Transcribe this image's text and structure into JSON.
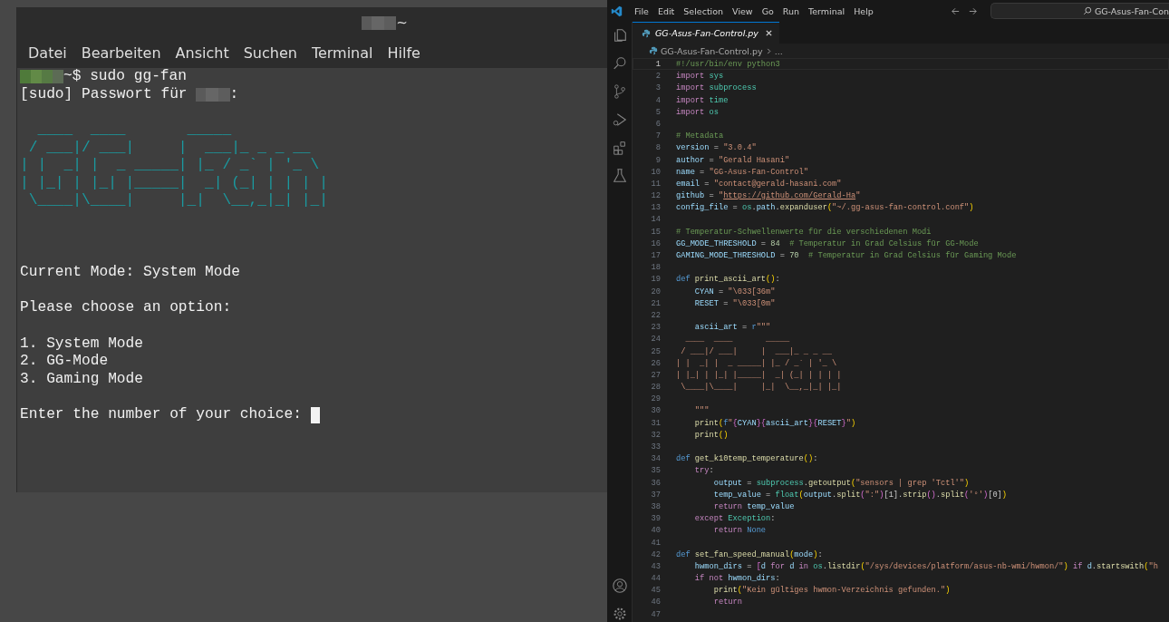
{
  "terminal": {
    "title": "~",
    "menu": [
      "Datei",
      "Bearbeiten",
      "Ansicht",
      "Suchen",
      "Terminal",
      "Hilfe"
    ],
    "lines": [
      {
        "kind": "prompt",
        "text": "~$ sudo gg-fan"
      },
      {
        "kind": "sudo",
        "text": "[sudo] Passwort für",
        "suffix": ":"
      },
      {
        "kind": "blank"
      },
      {
        "kind": "art",
        "text": "  ____  ____       _____"
      },
      {
        "kind": "art",
        "text": " / ___|/ ___|     |  ___|_ _ _ __"
      },
      {
        "kind": "art",
        "text": "| |  _| |  _ _____| |_ / _` | '_ \\"
      },
      {
        "kind": "art",
        "text": "| |_| | |_| |_____|  _| (_| | | | |"
      },
      {
        "kind": "art",
        "text": " \\____|\\____|     |_|  \\__,_|_| |_|"
      },
      {
        "kind": "blank"
      },
      {
        "kind": "blank"
      },
      {
        "kind": "blank"
      },
      {
        "kind": "text",
        "text": "Current Mode: System Mode"
      },
      {
        "kind": "blank"
      },
      {
        "kind": "text",
        "text": "Please choose an option:"
      },
      {
        "kind": "blank"
      },
      {
        "kind": "text",
        "text": "1. System Mode"
      },
      {
        "kind": "text",
        "text": "2. GG-Mode"
      },
      {
        "kind": "text",
        "text": "3. Gaming Mode"
      },
      {
        "kind": "blank"
      },
      {
        "kind": "input",
        "text": "Enter the number of your choice:"
      }
    ]
  },
  "editor": {
    "menu": [
      "File",
      "Edit",
      "Selection",
      "View",
      "Go",
      "Run",
      "Terminal",
      "Help"
    ],
    "search": {
      "value": "GG-Asus-Fan-Con"
    },
    "tabs": [
      {
        "label": "GG-Asus-Fan-Control.py",
        "selected": true
      }
    ],
    "breadcrumb": [
      "GG-Asus-Fan-Control.py",
      "..."
    ],
    "lines": [
      {
        "number": "1",
        "current": true,
        "tokens": [
          {
            "kind": "cm",
            "text": "#!/usr/bin/env python3"
          }
        ]
      },
      {
        "number": "2",
        "current": false,
        "tokens": [
          {
            "kind": "kw",
            "text": "import"
          },
          {
            "kind": "mod",
            "text": " sys"
          }
        ]
      },
      {
        "number": "3",
        "current": false,
        "tokens": [
          {
            "kind": "kw",
            "text": "import"
          },
          {
            "kind": "mod",
            "text": " subprocess"
          }
        ]
      },
      {
        "number": "4",
        "current": false,
        "tokens": [
          {
            "kind": "kw",
            "text": "import"
          },
          {
            "kind": "mod",
            "text": " time"
          }
        ]
      },
      {
        "number": "5",
        "current": false,
        "tokens": [
          {
            "kind": "kw",
            "text": "import"
          },
          {
            "kind": "mod",
            "text": " os"
          }
        ]
      },
      {
        "number": "6",
        "current": false
      },
      {
        "number": "7",
        "current": false,
        "tokens": [
          {
            "kind": "cm",
            "text": "# Metadata"
          }
        ]
      },
      {
        "number": "8",
        "current": false,
        "tokens": [
          {
            "kind": "var",
            "text": "version"
          },
          {
            "kind": "pl",
            "text": " = "
          },
          {
            "kind": "str",
            "text": "\"3.0.4\""
          }
        ]
      },
      {
        "number": "9",
        "current": false,
        "tokens": [
          {
            "kind": "var",
            "text": "author"
          },
          {
            "kind": "pl",
            "text": " = "
          },
          {
            "kind": "str",
            "text": "\"Gerald Hasani\""
          }
        ]
      },
      {
        "number": "10",
        "current": false,
        "tokens": [
          {
            "kind": "var",
            "text": "name"
          },
          {
            "kind": "pl",
            "text": " = "
          },
          {
            "kind": "str",
            "text": "\"GG-Asus-Fan-Control\""
          }
        ]
      },
      {
        "number": "11",
        "current": false,
        "tokens": [
          {
            "kind": "var",
            "text": "email"
          },
          {
            "kind": "pl",
            "text": " = "
          },
          {
            "kind": "str",
            "text": "\"contact@gerald-hasani.com\""
          }
        ]
      },
      {
        "number": "12",
        "current": false,
        "tokens": [
          {
            "kind": "var",
            "text": "github"
          },
          {
            "kind": "pl",
            "text": " = "
          },
          {
            "kind": "str",
            "text": "\""
          },
          {
            "kind": "link",
            "text": "https://github.com/Gerald-Ha"
          },
          {
            "kind": "str",
            "text": "\""
          }
        ]
      },
      {
        "number": "13",
        "current": false,
        "tokens": [
          {
            "kind": "var",
            "text": "config_file"
          },
          {
            "kind": "pl",
            "text": " = "
          },
          {
            "kind": "mod",
            "text": "os"
          },
          {
            "kind": "pl",
            "text": "."
          },
          {
            "kind": "var",
            "text": "path"
          },
          {
            "kind": "pl",
            "text": "."
          },
          {
            "kind": "fn",
            "text": "expanduser"
          },
          {
            "kind": "br",
            "text": "("
          },
          {
            "kind": "str",
            "text": "\"~/.gg-asus-fan-control.conf\""
          },
          {
            "kind": "br",
            "text": ")"
          }
        ]
      },
      {
        "number": "14",
        "current": false
      },
      {
        "number": "15",
        "current": false,
        "tokens": [
          {
            "kind": "cm",
            "text": "# Temperatur-Schwellenwerte für die verschiedenen Modi"
          }
        ]
      },
      {
        "number": "16",
        "current": false,
        "tokens": [
          {
            "kind": "var",
            "text": "GG_MODE_THRESHOLD"
          },
          {
            "kind": "pl",
            "text": " = "
          },
          {
            "kind": "num",
            "text": "84"
          },
          {
            "kind": "cm",
            "text": "  # Temperatur in Grad Celsius für GG-Mode"
          }
        ]
      },
      {
        "number": "17",
        "current": false,
        "tokens": [
          {
            "kind": "var",
            "text": "GAMING_MODE_THRESHOLD"
          },
          {
            "kind": "pl",
            "text": " = "
          },
          {
            "kind": "num",
            "text": "70"
          },
          {
            "kind": "cm",
            "text": "  # Temperatur in Grad Celsius für Gaming Mode"
          }
        ]
      },
      {
        "number": "18",
        "current": false
      },
      {
        "number": "19",
        "current": false,
        "tokens": [
          {
            "kind": "def",
            "text": "def"
          },
          {
            "kind": "fn",
            "text": " print_ascii_art"
          },
          {
            "kind": "br",
            "text": "()"
          },
          {
            "kind": "pl",
            "text": ":"
          }
        ]
      },
      {
        "number": "20",
        "current": false,
        "tokens": [
          {
            "kind": "var",
            "text": "    CYAN"
          },
          {
            "kind": "pl",
            "text": " = "
          },
          {
            "kind": "str",
            "text": "\"\\033[36m\""
          }
        ]
      },
      {
        "number": "21",
        "current": false,
        "tokens": [
          {
            "kind": "var",
            "text": "    RESET"
          },
          {
            "kind": "pl",
            "text": " = "
          },
          {
            "kind": "str",
            "text": "\"\\033[0m\""
          }
        ]
      },
      {
        "number": "22",
        "current": false
      },
      {
        "number": "23",
        "current": false,
        "tokens": [
          {
            "kind": "var",
            "text": "    ascii_art"
          },
          {
            "kind": "pl",
            "text": " = "
          },
          {
            "kind": "def",
            "text": "r"
          },
          {
            "kind": "str",
            "text": "\"\"\""
          }
        ]
      },
      {
        "number": "24",
        "current": false,
        "tokens": [
          {
            "kind": "str",
            "text": "  ____  ____       _____"
          }
        ]
      },
      {
        "number": "25",
        "current": false,
        "tokens": [
          {
            "kind": "str",
            "text": " / ___|/ ___|     |  ___|_ _ _ __"
          }
        ]
      },
      {
        "number": "26",
        "current": false,
        "tokens": [
          {
            "kind": "str",
            "text": "| |  _| |  _ _____| |_ / _` | '_ \\"
          }
        ]
      },
      {
        "number": "27",
        "current": false,
        "tokens": [
          {
            "kind": "str",
            "text": "| |_| | |_| |_____|  _| (_| | | | |"
          }
        ]
      },
      {
        "number": "28",
        "current": false,
        "tokens": [
          {
            "kind": "str",
            "text": " \\____|\\____|     |_|  \\__,_|_| |_|"
          }
        ]
      },
      {
        "number": "29",
        "current": false
      },
      {
        "number": "30",
        "current": false,
        "tokens": [
          {
            "kind": "str",
            "text": "    \"\"\""
          }
        ]
      },
      {
        "number": "31",
        "current": false,
        "tokens": [
          {
            "kind": "fn",
            "text": "    print"
          },
          {
            "kind": "br",
            "text": "("
          },
          {
            "kind": "def",
            "text": "f"
          },
          {
            "kind": "str",
            "text": "\""
          },
          {
            "kind": "br2",
            "text": "{"
          },
          {
            "kind": "var",
            "text": "CYAN"
          },
          {
            "kind": "br2",
            "text": "}{"
          },
          {
            "kind": "var",
            "text": "ascii_art"
          },
          {
            "kind": "br2",
            "text": "}{"
          },
          {
            "kind": "var",
            "text": "RESET"
          },
          {
            "kind": "br2",
            "text": "}"
          },
          {
            "kind": "str",
            "text": "\""
          },
          {
            "kind": "br",
            "text": ")"
          }
        ]
      },
      {
        "number": "32",
        "current": false,
        "tokens": [
          {
            "kind": "fn",
            "text": "    print"
          },
          {
            "kind": "br",
            "text": "()"
          }
        ]
      },
      {
        "number": "33",
        "current": false
      },
      {
        "number": "34",
        "current": false,
        "tokens": [
          {
            "kind": "def",
            "text": "def"
          },
          {
            "kind": "fn",
            "text": " get_k10temp_temperature"
          },
          {
            "kind": "br",
            "text": "()"
          },
          {
            "kind": "pl",
            "text": ":"
          }
        ]
      },
      {
        "number": "35",
        "current": false,
        "tokens": [
          {
            "kind": "kw",
            "text": "    try"
          },
          {
            "kind": "pl",
            "text": ":"
          }
        ]
      },
      {
        "number": "36",
        "current": false,
        "tokens": [
          {
            "kind": "var",
            "text": "        output"
          },
          {
            "kind": "pl",
            "text": " = "
          },
          {
            "kind": "mod",
            "text": "subprocess"
          },
          {
            "kind": "pl",
            "text": "."
          },
          {
            "kind": "fn",
            "text": "getoutput"
          },
          {
            "kind": "br",
            "text": "("
          },
          {
            "kind": "str",
            "text": "\"sensors | grep 'Tctl'\""
          },
          {
            "kind": "br",
            "text": ")"
          }
        ]
      },
      {
        "number": "37",
        "current": false,
        "tokens": [
          {
            "kind": "var",
            "text": "        temp_value"
          },
          {
            "kind": "pl",
            "text": " = "
          },
          {
            "kind": "mod",
            "text": "float"
          },
          {
            "kind": "br",
            "text": "("
          },
          {
            "kind": "var",
            "text": "output"
          },
          {
            "kind": "pl",
            "text": "."
          },
          {
            "kind": "fn",
            "text": "split"
          },
          {
            "kind": "br2",
            "text": "("
          },
          {
            "kind": "str",
            "text": "\":\""
          },
          {
            "kind": "br2",
            "text": ")"
          },
          {
            "kind": "pl",
            "text": "[1]."
          },
          {
            "kind": "fn",
            "text": "strip"
          },
          {
            "kind": "br2",
            "text": "()"
          },
          {
            "kind": "pl",
            "text": "."
          },
          {
            "kind": "fn",
            "text": "split"
          },
          {
            "kind": "br2",
            "text": "("
          },
          {
            "kind": "str",
            "text": "'°'"
          },
          {
            "kind": "br2",
            "text": ")"
          },
          {
            "kind": "pl",
            "text": "[0]"
          },
          {
            "kind": "br",
            "text": ")"
          }
        ]
      },
      {
        "number": "38",
        "current": false,
        "tokens": [
          {
            "kind": "kw",
            "text": "        return"
          },
          {
            "kind": "var",
            "text": " temp_value"
          }
        ]
      },
      {
        "number": "39",
        "current": false,
        "tokens": [
          {
            "kind": "kw",
            "text": "    except"
          },
          {
            "kind": "mod",
            "text": " Exception"
          },
          {
            "kind": "pl",
            "text": ":"
          }
        ]
      },
      {
        "number": "40",
        "current": false,
        "tokens": [
          {
            "kind": "kw",
            "text": "        return"
          },
          {
            "kind": "def",
            "text": " None"
          }
        ]
      },
      {
        "number": "41",
        "current": false
      },
      {
        "number": "42",
        "current": false,
        "tokens": [
          {
            "kind": "def",
            "text": "def"
          },
          {
            "kind": "fn",
            "text": " set_fan_speed_manual"
          },
          {
            "kind": "br",
            "text": "("
          },
          {
            "kind": "var",
            "text": "mode"
          },
          {
            "kind": "br",
            "text": ")"
          },
          {
            "kind": "pl",
            "text": ":"
          }
        ]
      },
      {
        "number": "43",
        "current": false,
        "tokens": [
          {
            "kind": "var",
            "text": "    hwmon_dirs"
          },
          {
            "kind": "pl",
            "text": " = "
          },
          {
            "kind": "br2",
            "text": "["
          },
          {
            "kind": "var",
            "text": "d"
          },
          {
            "kind": "kw",
            "text": " for"
          },
          {
            "kind": "var",
            "text": " d"
          },
          {
            "kind": "kw",
            "text": " in"
          },
          {
            "kind": "mod",
            "text": " os"
          },
          {
            "kind": "pl",
            "text": "."
          },
          {
            "kind": "fn",
            "text": "listdir"
          },
          {
            "kind": "br",
            "text": "("
          },
          {
            "kind": "str",
            "text": "\"/sys/devices/platform/asus-nb-wmi/hwmon/\""
          },
          {
            "kind": "br",
            "text": ")"
          },
          {
            "kind": "kw",
            "text": " if"
          },
          {
            "kind": "var",
            "text": " d"
          },
          {
            "kind": "pl",
            "text": "."
          },
          {
            "kind": "fn",
            "text": "startswith"
          },
          {
            "kind": "br",
            "text": "("
          },
          {
            "kind": "str",
            "text": "\"h"
          }
        ]
      },
      {
        "number": "44",
        "current": false,
        "tokens": [
          {
            "kind": "kw",
            "text": "    if not"
          },
          {
            "kind": "var",
            "text": " hwmon_dirs"
          },
          {
            "kind": "pl",
            "text": ":"
          }
        ]
      },
      {
        "number": "45",
        "current": false,
        "tokens": [
          {
            "kind": "fn",
            "text": "        print"
          },
          {
            "kind": "br",
            "text": "("
          },
          {
            "kind": "str",
            "text": "\"Kein gültiges hwmon-Verzeichnis gefunden.\""
          },
          {
            "kind": "br",
            "text": ")"
          }
        ]
      },
      {
        "number": "46",
        "current": false,
        "tokens": [
          {
            "kind": "kw",
            "text": "        return"
          }
        ]
      },
      {
        "number": "47",
        "current": false
      }
    ]
  }
}
